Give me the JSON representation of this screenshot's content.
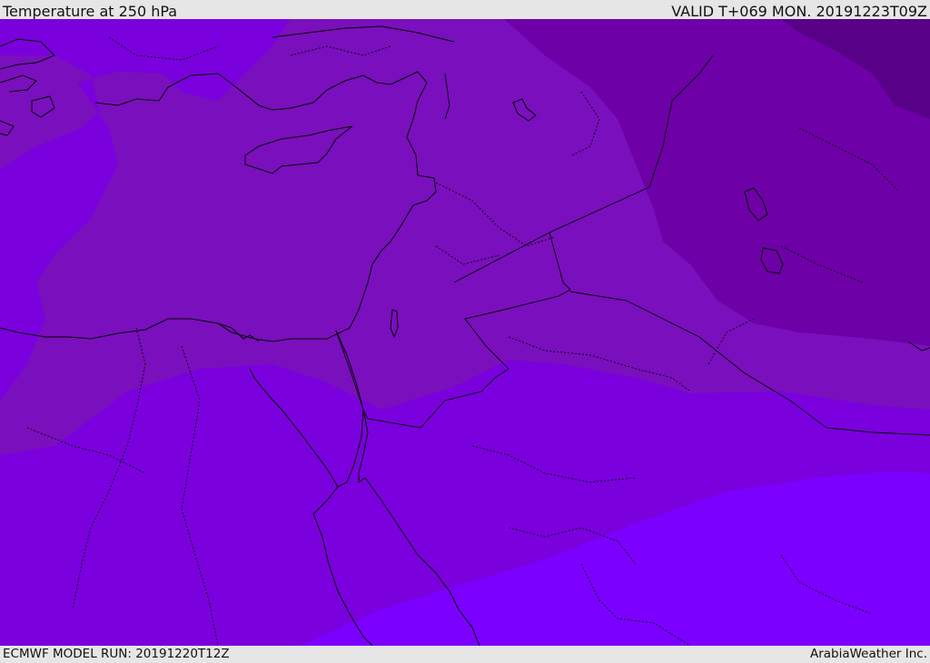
{
  "header": {
    "title": "Temperature at 250 hPa",
    "valid_time": "VALID T+069 MON. 20191223T09Z"
  },
  "footer": {
    "model_run": "ECMWF MODEL RUN: 20191220T12Z",
    "credit": "ArabiaWeather Inc."
  },
  "map": {
    "colors": {
      "band_warm": "#7b00ff",
      "band_mid": "#7a00dd",
      "band_cool": "#7a0fbd",
      "band_colder": "#6d00a6",
      "band_coldest": "#590088",
      "coast": "#000000"
    }
  }
}
